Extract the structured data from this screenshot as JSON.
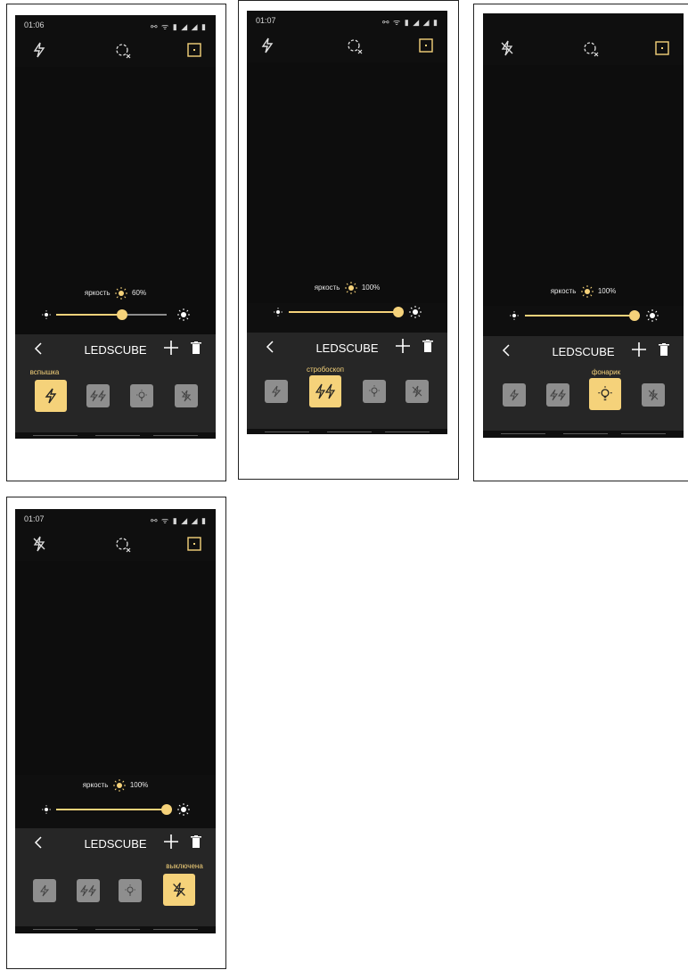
{
  "colors": {
    "accent": "#f5d27a",
    "background": "#0f0f0f",
    "panel": "#262626",
    "inactive_mode": "#8e8e8e"
  },
  "screens": [
    {
      "status_time": "01:06",
      "status_icons": "⚯ ᯤ ▮ ◢ ◢ ▮",
      "flash_icon": "flash-auto-icon",
      "brightness_label": "яркость",
      "brightness_value": "60%",
      "brightness_level": 0.6,
      "device_title": "LEDSCUBE",
      "selected_mode": 0,
      "selected_label": "вспышка"
    },
    {
      "status_time": "01:07",
      "status_icons": "⚯ ᯤ ▮ ◢ ◢ ▮",
      "flash_icon": "flash-auto-icon",
      "brightness_label": "яркость",
      "brightness_value": "100%",
      "brightness_level": 1.0,
      "device_title": "LEDSCUBE",
      "selected_mode": 1,
      "selected_label": "стробоскоп"
    },
    {
      "status_time": "",
      "status_icons": "",
      "flash_icon": "flash-off-icon",
      "brightness_label": "яркость",
      "brightness_value": "100%",
      "brightness_level": 1.0,
      "device_title": "LEDSCUBE",
      "selected_mode": 2,
      "selected_label": "фонарик"
    },
    {
      "status_time": "01:07",
      "status_icons": "⚯ ᯤ ▮ ◢ ◢ ▮",
      "flash_icon": "flash-off-icon",
      "brightness_label": "яркость",
      "brightness_value": "100%",
      "brightness_level": 1.0,
      "device_title": "LEDSCUBE",
      "selected_mode": 3,
      "selected_label": "выключена"
    }
  ],
  "modes": [
    {
      "name": "flash",
      "icon": "flash-icon"
    },
    {
      "name": "strobe",
      "icon": "strobe-icon"
    },
    {
      "name": "torch",
      "icon": "bulb-icon"
    },
    {
      "name": "off",
      "icon": "flash-off-icon"
    }
  ]
}
